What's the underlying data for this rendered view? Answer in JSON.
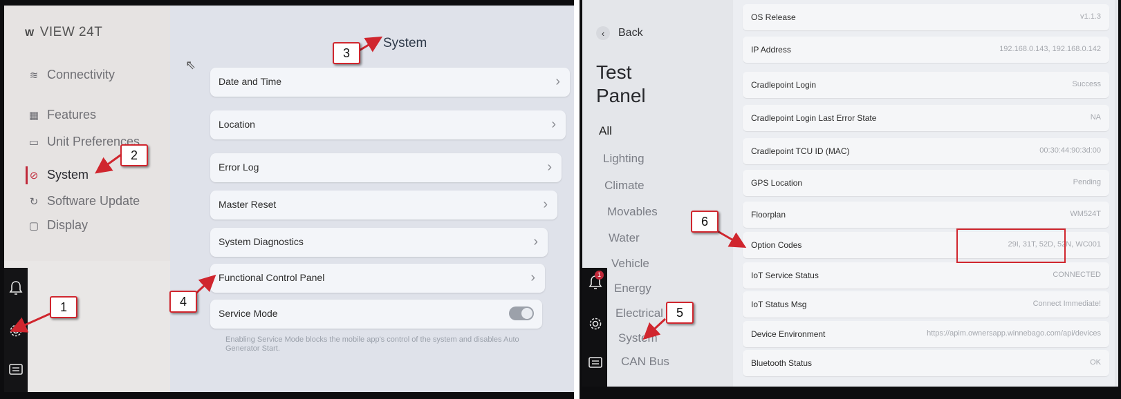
{
  "left_screen": {
    "brand": "VIEW 24T",
    "brand_mark": "W",
    "nav": [
      {
        "icon": "wifi-icon",
        "glyph": "≋",
        "label": "Connectivity"
      },
      {
        "icon": "grid-icon",
        "glyph": "▦",
        "label": "Features"
      },
      {
        "icon": "ruler-icon",
        "glyph": "▭",
        "label": "Unit Preferences"
      },
      {
        "icon": "system-icon",
        "glyph": "⊘",
        "label": "System",
        "active": true
      },
      {
        "icon": "refresh-icon",
        "glyph": "↻",
        "label": "Software Update"
      },
      {
        "icon": "display-icon",
        "glyph": "▢",
        "label": "Display"
      }
    ],
    "panel_title": "System",
    "rows": [
      "Date and Time",
      "Location",
      "Error Log",
      "Master Reset",
      "System Diagnostics",
      "Functional Control Panel"
    ],
    "service_mode": {
      "label": "Service Mode",
      "toggle_on": false,
      "description": "Enabling Service Mode blocks the mobile app's control of the system and disables Auto Generator Start."
    }
  },
  "right_screen": {
    "back_label": "Back",
    "title_line1": "Test",
    "title_line2": "Panel",
    "categories": [
      "All",
      "Lighting",
      "Climate",
      "Movables",
      "Water",
      "Vehicle",
      "Energy",
      "Electrical",
      "System",
      "CAN Bus"
    ],
    "notification_count": "1",
    "items": [
      {
        "key": "OS Release",
        "value": "v1.1.3"
      },
      {
        "key": "IP Address",
        "value": "192.168.0.143, 192.168.0.142"
      },
      {
        "key": "Cradlepoint Login",
        "value": "Success"
      },
      {
        "key": "Cradlepoint Login Last Error State",
        "value": "NA"
      },
      {
        "key": "Cradlepoint TCU ID (MAC)",
        "value": "00:30:44:90:3d:00"
      },
      {
        "key": "GPS Location",
        "value": "Pending"
      },
      {
        "key": "Floorplan",
        "value": "WM524T"
      },
      {
        "key": "Option Codes",
        "value": "29I, 31T, 52D, 52N, WC001"
      },
      {
        "key": "IoT Service Status",
        "value": "CONNECTED"
      },
      {
        "key": "IoT Status Msg",
        "value": "Connect Immediate!"
      },
      {
        "key": "Device Environment",
        "value": "https://apim.ownersapp.winnebago.com/api/devices"
      },
      {
        "key": "Bluetooth Status",
        "value": "OK"
      }
    ]
  },
  "annotations": [
    "1",
    "2",
    "3",
    "4",
    "5",
    "6"
  ],
  "colors": {
    "annotation": "#d0262e",
    "active_nav": "#c0293a"
  }
}
